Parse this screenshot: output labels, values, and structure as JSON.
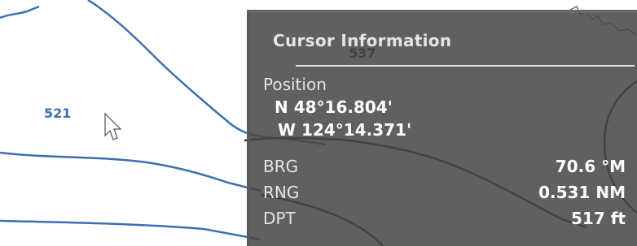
{
  "chart": {
    "depth_labels": {
      "shallow": "521",
      "deep": "537"
    },
    "contour_color": "#3d6fb0",
    "track_color": "#1e3258"
  },
  "cursor_icon": "arrow-cursor-icon",
  "cursor_info": {
    "title": "Cursor Information",
    "position_label": "Position",
    "lat": "N 48°16.804'",
    "lon": "W 124°14.371'",
    "rows": [
      {
        "label": "BRG",
        "value": "70.6 °M"
      },
      {
        "label": "RNG",
        "value": "0.531 NM"
      },
      {
        "label": "DPT",
        "value": "517 ft"
      }
    ]
  }
}
